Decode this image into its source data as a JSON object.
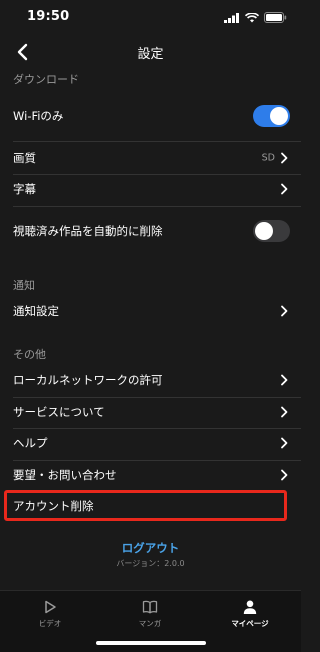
{
  "status": {
    "time": "19:50"
  },
  "nav": {
    "title": "設定"
  },
  "sections": {
    "download": "ダウンロード",
    "notify": "通知",
    "other": "その他"
  },
  "rows": {
    "wifi": {
      "label": "Wi-Fiのみ",
      "toggle": true
    },
    "quality": {
      "label": "画質",
      "value": "SD"
    },
    "subtitles": {
      "label": "字幕"
    },
    "autodelete": {
      "label": "視聴済み作品を自動的に削除",
      "toggle": false
    },
    "notify_settings": {
      "label": "通知設定"
    },
    "local_network": {
      "label": "ローカルネットワークの許可"
    },
    "about": {
      "label": "サービスについて"
    },
    "help": {
      "label": "ヘルプ"
    },
    "contact": {
      "label": "要望・お問い合わせ"
    },
    "delete_account": {
      "label": "アカウント削除"
    }
  },
  "footer": {
    "logout": "ログアウト",
    "version": "バージョン：2.0.0"
  },
  "tabs": [
    {
      "label": "ビデオ",
      "icon": "play-icon",
      "active": false
    },
    {
      "label": "マンガ",
      "icon": "book-icon",
      "active": false
    },
    {
      "label": "マイページ",
      "icon": "person-icon",
      "active": true
    }
  ],
  "colors": {
    "accent": "#2e7dea",
    "highlight": "#e8281c",
    "link": "#4aa3e8"
  }
}
